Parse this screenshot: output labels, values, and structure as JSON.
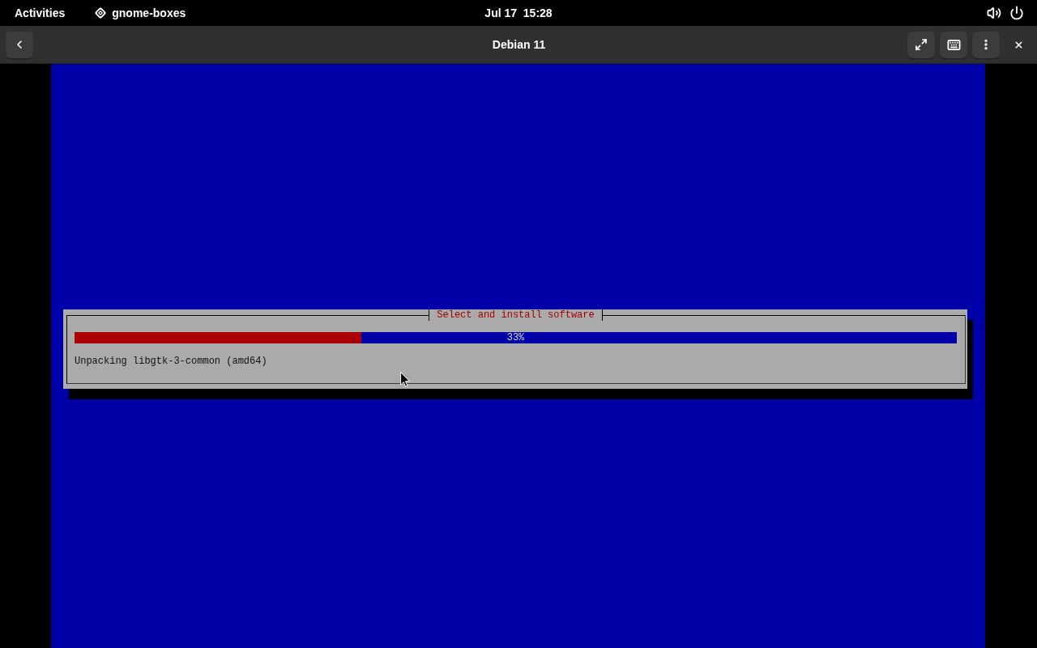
{
  "top_bar": {
    "activities": "Activities",
    "app_name": "gnome-boxes",
    "clock": "Jul 17  15:28"
  },
  "header_bar": {
    "title": "Debian 11"
  },
  "installer": {
    "dialog_title": "Select and install software",
    "progress": {
      "level": 0.325,
      "reading": "33%"
    },
    "status": "Unpacking libgtk-3-common (amd64)"
  }
}
